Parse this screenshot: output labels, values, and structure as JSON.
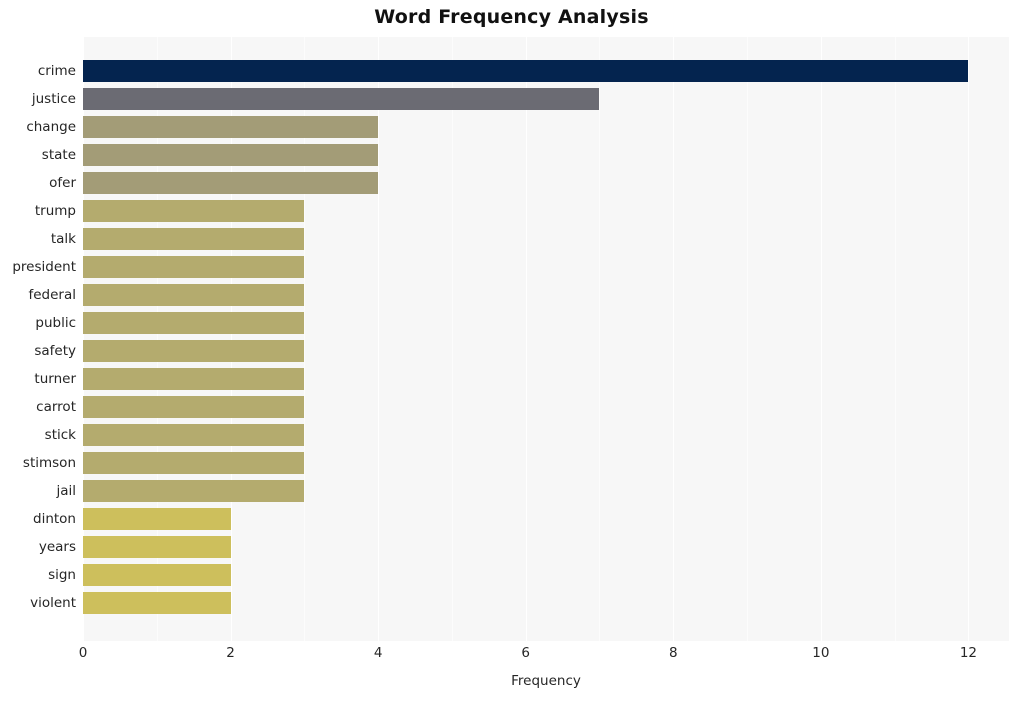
{
  "chart_data": {
    "type": "bar",
    "orientation": "horizontal",
    "title": "Word Frequency Analysis",
    "xlabel": "Frequency",
    "ylabel": "",
    "categories": [
      "crime",
      "justice",
      "change",
      "state",
      "ofer",
      "trump",
      "talk",
      "president",
      "federal",
      "public",
      "safety",
      "turner",
      "carrot",
      "stick",
      "stimson",
      "jail",
      "dinton",
      "years",
      "sign",
      "violent"
    ],
    "values": [
      12,
      7,
      4,
      4,
      4,
      3,
      3,
      3,
      3,
      3,
      3,
      3,
      3,
      3,
      3,
      3,
      2,
      2,
      2,
      2
    ],
    "bar_colors": [
      "#04244f",
      "#6b6b73",
      "#a39c77",
      "#a39c77",
      "#a39c77",
      "#b4ab6e",
      "#b4ab6e",
      "#b4ab6e",
      "#b4ab6e",
      "#b4ab6e",
      "#b4ab6e",
      "#b4ab6e",
      "#b4ab6e",
      "#b4ab6e",
      "#b4ab6e",
      "#b4ab6e",
      "#cdbf5c",
      "#cdbf5c",
      "#cdbf5c",
      "#cdbf5c"
    ],
    "xlim": [
      0,
      12.55
    ],
    "x_ticks": [
      0,
      2,
      4,
      6,
      8,
      10,
      12
    ],
    "x_tick_labels": [
      "0",
      "2",
      "4",
      "6",
      "8",
      "10",
      "12"
    ],
    "grid": true,
    "grid_axis": "x",
    "legend": false,
    "plot_background": "#f7f7f7",
    "gridline_color": "#ffffff",
    "figure_background": "#ffffff",
    "text_color": "#262626",
    "title_color": "#111111"
  }
}
